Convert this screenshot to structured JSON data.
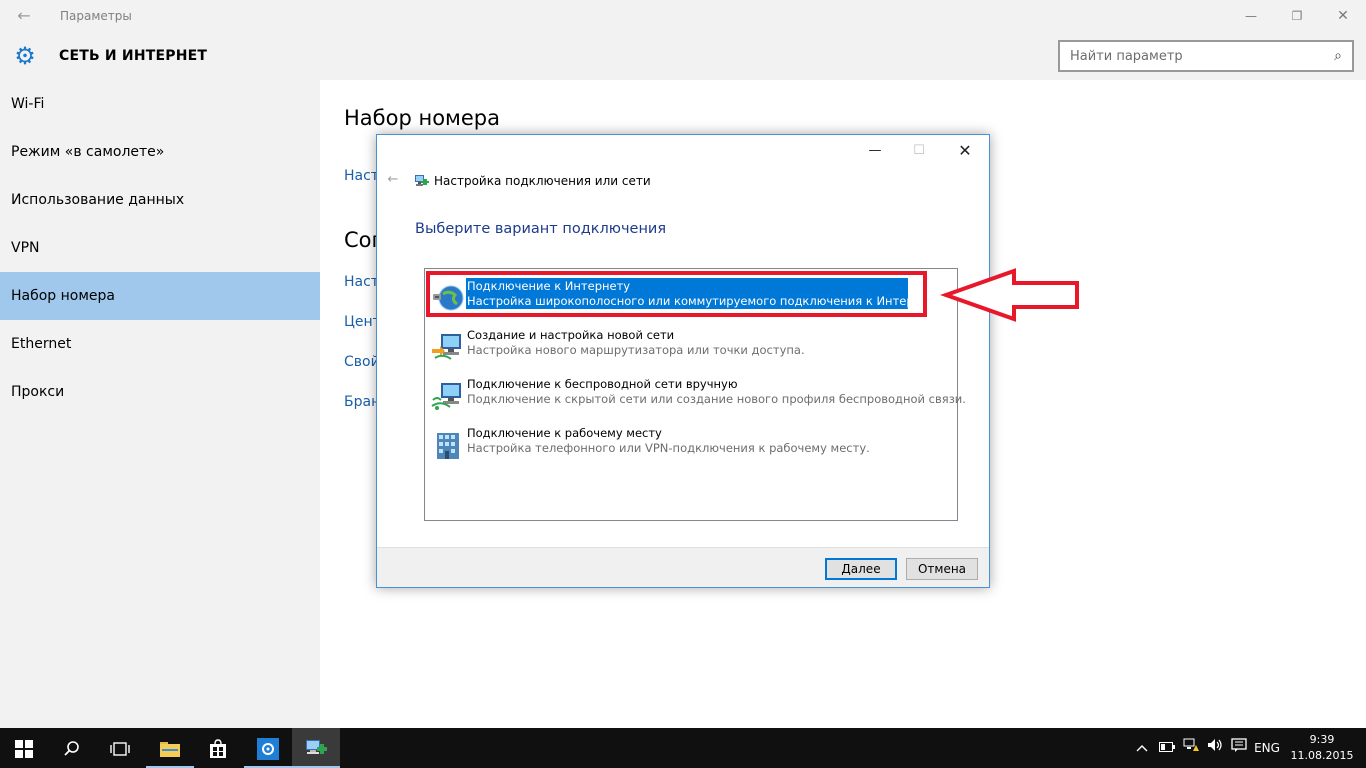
{
  "window": {
    "title": "Параметры",
    "back_glyph": "←",
    "minimize_glyph": "—",
    "maximize_glyph": "❐",
    "close_glyph": "✕"
  },
  "header": {
    "section_title": "СЕТЬ И ИНТЕРНЕТ",
    "gear_glyph": "⚙",
    "search": {
      "placeholder": "Найти параметр",
      "icon_glyph": "⌕"
    }
  },
  "sidebar": {
    "items": [
      {
        "label": "Wi-Fi"
      },
      {
        "label": "Режим «в самолете»"
      },
      {
        "label": "Использование данных"
      },
      {
        "label": "VPN"
      },
      {
        "label": "Набор номера"
      },
      {
        "label": "Ethernet"
      },
      {
        "label": "Прокси"
      }
    ],
    "active_index": 4
  },
  "main": {
    "heading": "Набор номера",
    "link1": "Наст",
    "heading2": "Соп",
    "links": [
      "Наст",
      "Цент",
      "Свой",
      "Бран"
    ]
  },
  "dialog": {
    "title": "Настройка подключения или сети",
    "back_glyph": "←",
    "minimize_glyph": "—",
    "maximize_glyph": "☐",
    "close_glyph": "✕",
    "heading": "Выберите вариант подключения",
    "options": [
      {
        "title": "Подключение к Интернету",
        "desc": "Настройка широкополосного или коммутируемого подключения к Интернету.",
        "icon": "globe-icon",
        "selected": true
      },
      {
        "title": "Создание и настройка новой сети",
        "desc": "Настройка нового маршрутизатора или точки доступа.",
        "icon": "network-setup-icon",
        "selected": false
      },
      {
        "title": "Подключение к беспроводной сети вручную",
        "desc": "Подключение к скрытой сети или создание нового профиля беспроводной связи.",
        "icon": "wireless-network-icon",
        "selected": false
      },
      {
        "title": "Подключение к рабочему месту",
        "desc": "Настройка телефонного или VPN-подключения к рабочему месту.",
        "icon": "workplace-icon",
        "selected": false
      }
    ],
    "next_label": "Далее",
    "cancel_label": "Отмена"
  },
  "colors": {
    "accent": "#0078d7",
    "sidebar_active": "#a0c8ec",
    "annotation_red": "#e8182a"
  },
  "taskbar": {
    "language": "ENG",
    "time": "9:39",
    "date": "11.08.2015"
  }
}
